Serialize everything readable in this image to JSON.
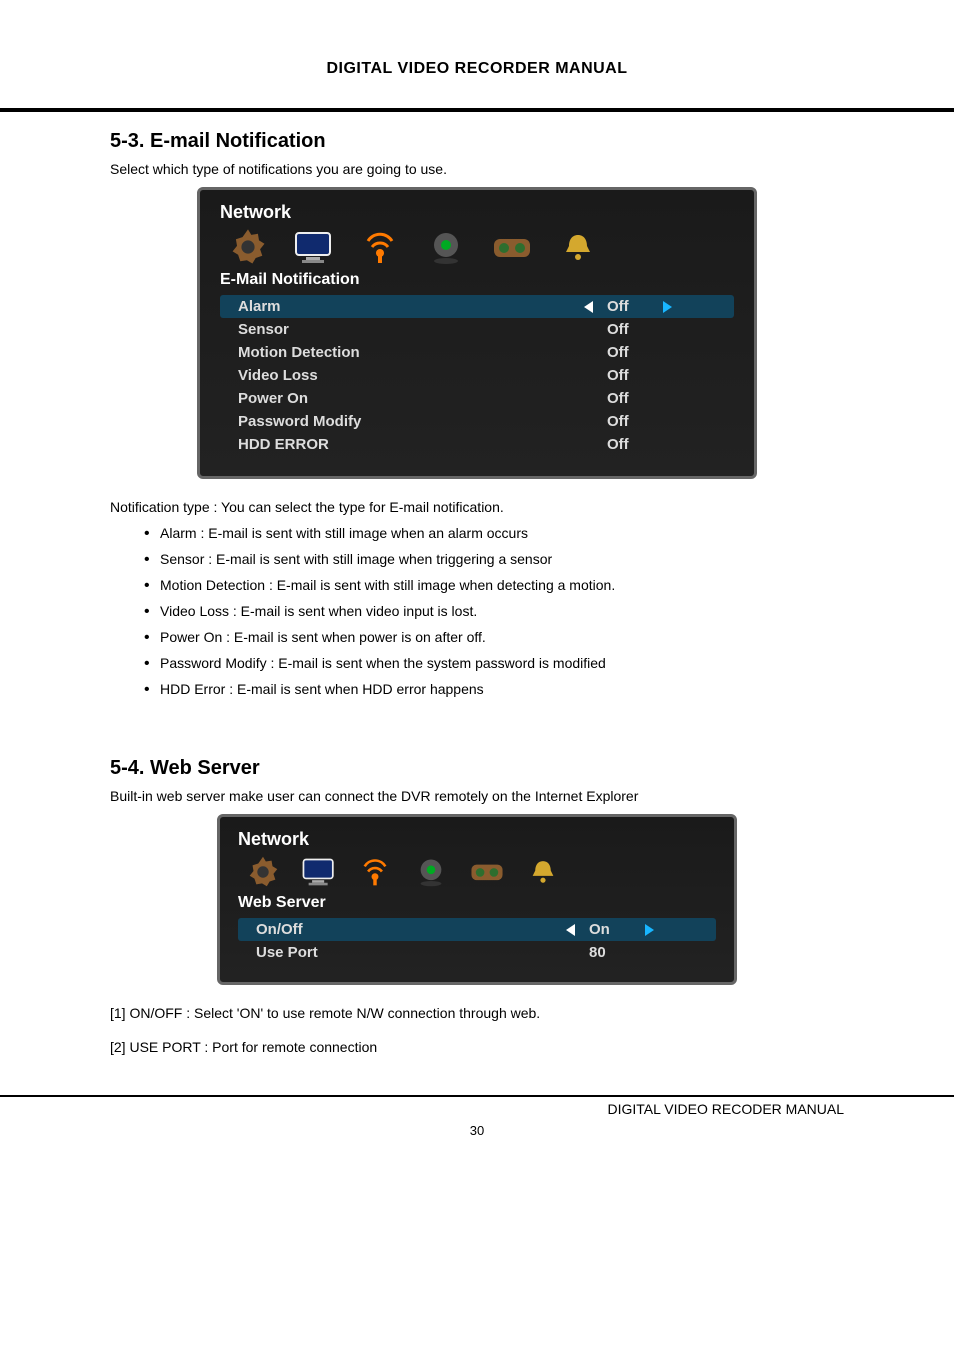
{
  "header": {
    "title": "DIGITAL VIDEO RECORDER MANUAL"
  },
  "section1": {
    "heading": "5-3. E-mail Notification",
    "intro": "Select which type of notifications you are going to use.",
    "screenshot": {
      "title": "Network",
      "section_label": "E-Mail Notification",
      "icons": [
        "settings-icon",
        "monitor-icon",
        "wireless-icon",
        "webcam-icon",
        "vr-icon",
        "bell-icon"
      ],
      "rows": [
        {
          "label": "Alarm",
          "value": "Off",
          "highlight": true
        },
        {
          "label": "Sensor",
          "value": "Off",
          "highlight": false
        },
        {
          "label": "Motion Detection",
          "value": "Off",
          "highlight": false
        },
        {
          "label": "Video Loss",
          "value": "Off",
          "highlight": false
        },
        {
          "label": "Power On",
          "value": "Off",
          "highlight": false
        },
        {
          "label": "Password Modify",
          "value": "Off",
          "highlight": false
        },
        {
          "label": "HDD ERROR",
          "value": "Off",
          "highlight": false
        }
      ]
    },
    "after_shot": "Notification type : You can select the type for E-mail notification.",
    "bullets": [
      "Alarm : E-mail is sent with still image when an alarm occurs",
      "Sensor : E-mail is sent with still image when triggering a sensor",
      "Motion Detection : E-mail is sent with still image when detecting a motion.",
      "Video Loss : E-mail is sent when video input is lost.",
      "Power On : E-mail is sent when power is on after off.",
      "Password Modify : E-mail is sent when the system password is modified",
      "HDD Error : E-mail is sent when HDD error happens"
    ]
  },
  "section2": {
    "heading": "5-4. Web Server",
    "intro": "Built-in web server make user can connect the DVR remotely on the Internet Explorer",
    "screenshot": {
      "title": "Network",
      "section_label": "Web Server",
      "icons": [
        "settings-icon",
        "monitor-icon",
        "wireless-icon",
        "webcam-icon",
        "vr-icon",
        "bell-icon"
      ],
      "rows": [
        {
          "label": "On/Off",
          "value": "On",
          "highlight": true
        },
        {
          "label": "Use Port",
          "value": "80",
          "highlight": false
        }
      ]
    },
    "notes": [
      "[1] ON/OFF : Select 'ON' to use remote N/W connection through web.",
      "[2] USE PORT : Port for remote connection"
    ]
  },
  "footer": {
    "text": "DIGITAL VIDEO RECODER MANUAL",
    "page": "30"
  }
}
